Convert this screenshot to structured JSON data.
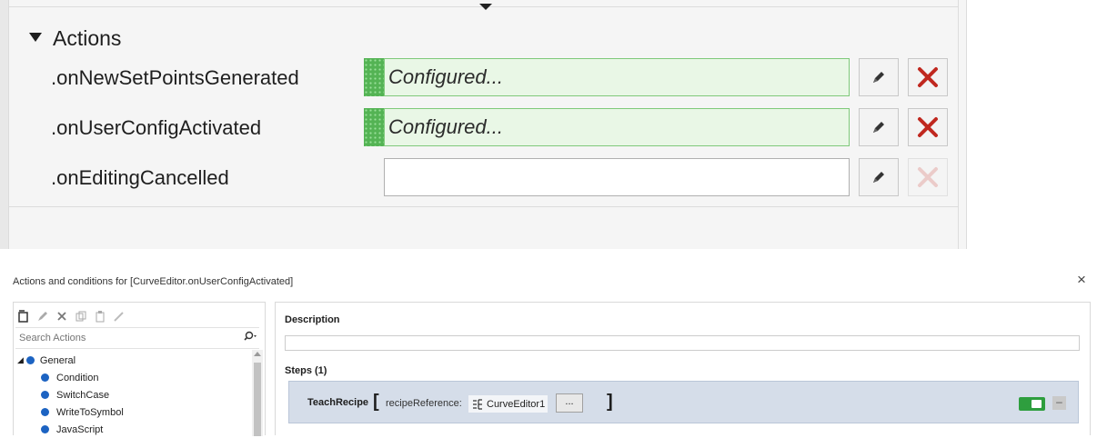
{
  "properties_panel": {
    "section_title": "Actions",
    "rows": [
      {
        "label": ".onNewSetPointsGenerated",
        "value": "Configured...",
        "configured": true
      },
      {
        "label": ".onUserConfigActivated",
        "value": "Configured...",
        "configured": true
      },
      {
        "label": ".onEditingCancelled",
        "value": "",
        "configured": false
      }
    ],
    "edit_icon": "pencil-icon",
    "delete_icon": "red-x-icon",
    "accent_configured": "#54b354",
    "delete_color": "#c0281f"
  },
  "dialog": {
    "title": "Actions and conditions for [CurveEditor.onUserConfigActivated]",
    "close_label": "×",
    "search": {
      "placeholder": "Search Actions"
    },
    "tree": {
      "group": "General",
      "items": [
        "Condition",
        "SwitchCase",
        "WriteToSymbol",
        "JavaScript"
      ]
    },
    "description_label": "Description",
    "description_value": "",
    "steps_label": "Steps (1)",
    "step": {
      "name": "TeachRecipe",
      "open_bracket": "[",
      "close_bracket": "]",
      "param_label": "recipeReference:",
      "param_value": "CurveEditor1",
      "browse_label": "...",
      "enabled": true,
      "collapse_label": "–"
    }
  }
}
